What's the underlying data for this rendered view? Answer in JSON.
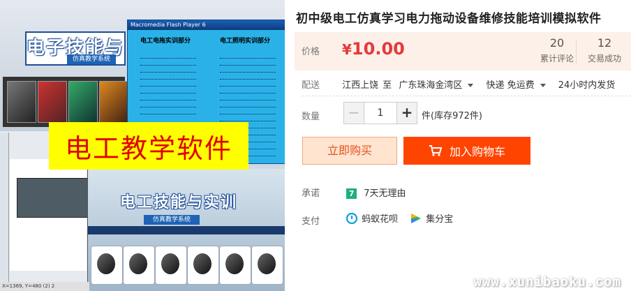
{
  "product": {
    "title": "初中级电工仿真学习电力拖动设备维修技能培训模拟软件",
    "banner_text": "电工教学软件"
  },
  "price": {
    "label": "价格",
    "symbol": "¥",
    "value": "10.00",
    "accent": "#e4393c"
  },
  "stats": [
    {
      "count": "20",
      "label": "累计评论"
    },
    {
      "count": "12",
      "label": "交易成功"
    }
  ],
  "shipping": {
    "label": "配送",
    "from": "江西上饶",
    "to_word": "至",
    "dest": "广东珠海金湾区",
    "method": "快递 免运费",
    "dispatch": "24小时内发货"
  },
  "quantity": {
    "label": "数量",
    "value": "1",
    "stock": "件(库存972件)"
  },
  "actions": {
    "buy_now": "立即购买",
    "add_cart": "加入购物车",
    "brand": "#ff4400"
  },
  "promise": {
    "label": "承诺",
    "icon_char": "7",
    "text": "7天无理由"
  },
  "payment": {
    "label": "支付",
    "items": [
      "蚂蚁花呗",
      "集分宝"
    ]
  },
  "watermark": "www.xunibaoku.com",
  "collage": {
    "title1": "电子技能与",
    "sub1": "仿真教学系统",
    "window_title": "Macromedia Flash Player 6",
    "col1": "电工电拖实训部分",
    "col2": "电工照明实训部分",
    "title2": "电工技能与实训",
    "sub2": "仿真教学系统",
    "status": "X=1369, Y=480 (2) 2"
  }
}
